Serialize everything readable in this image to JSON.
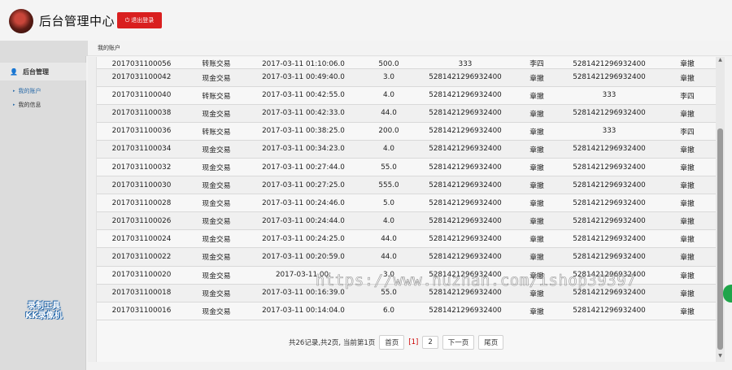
{
  "header": {
    "title": "后台管理中心",
    "logout_label": "退出登录"
  },
  "breadcrumb": "我的账户",
  "sidebar": {
    "group_label": "后台管理",
    "items": [
      {
        "label": "我的账户"
      },
      {
        "label": "我的信息"
      }
    ],
    "recorder_watermark_line1": "录制工具",
    "recorder_watermark_line2": "KK录像机"
  },
  "table": {
    "rows": [
      [
        "2017031100056",
        "转账交易",
        "2017-03-11 01:10:06.0",
        "500.0",
        "333",
        "李四",
        "5281421296932400",
        "章撤"
      ],
      [
        "2017031100042",
        "现金交易",
        "2017-03-11 00:49:40.0",
        "3.0",
        "5281421296932400",
        "章撤",
        "5281421296932400",
        "章撤"
      ],
      [
        "2017031100040",
        "转账交易",
        "2017-03-11 00:42:55.0",
        "4.0",
        "5281421296932400",
        "章撤",
        "333",
        "李四"
      ],
      [
        "2017031100038",
        "现金交易",
        "2017-03-11 00:42:33.0",
        "44.0",
        "5281421296932400",
        "章撤",
        "5281421296932400",
        "章撤"
      ],
      [
        "2017031100036",
        "转账交易",
        "2017-03-11 00:38:25.0",
        "200.0",
        "5281421296932400",
        "章撤",
        "333",
        "李四"
      ],
      [
        "2017031100034",
        "现金交易",
        "2017-03-11 00:34:23.0",
        "4.0",
        "5281421296932400",
        "章撤",
        "5281421296932400",
        "章撤"
      ],
      [
        "2017031100032",
        "现金交易",
        "2017-03-11 00:27:44.0",
        "55.0",
        "5281421296932400",
        "章撤",
        "5281421296932400",
        "章撤"
      ],
      [
        "2017031100030",
        "现金交易",
        "2017-03-11 00:27:25.0",
        "555.0",
        "5281421296932400",
        "章撤",
        "5281421296932400",
        "章撤"
      ],
      [
        "2017031100028",
        "现金交易",
        "2017-03-11 00:24:46.0",
        "5.0",
        "5281421296932400",
        "章撤",
        "5281421296932400",
        "章撤"
      ],
      [
        "2017031100026",
        "现金交易",
        "2017-03-11 00:24:44.0",
        "4.0",
        "5281421296932400",
        "章撤",
        "5281421296932400",
        "章撤"
      ],
      [
        "2017031100024",
        "现金交易",
        "2017-03-11 00:24:25.0",
        "44.0",
        "5281421296932400",
        "章撤",
        "5281421296932400",
        "章撤"
      ],
      [
        "2017031100022",
        "现金交易",
        "2017-03-11 00:20:59.0",
        "44.0",
        "5281421296932400",
        "章撤",
        "5281421296932400",
        "章撤"
      ],
      [
        "2017031100020",
        "现金交易",
        "2017-03-11 00:",
        "3.0",
        "5281421296932400",
        "章撤",
        "5281421296932400",
        "章撤"
      ],
      [
        "2017031100018",
        "现金交易",
        "2017-03-11 00:16:39.0",
        "55.0",
        "5281421296932400",
        "章撤",
        "5281421296932400",
        "章撤"
      ],
      [
        "2017031100016",
        "现金交易",
        "2017-03-11 00:14:04.0",
        "6.0",
        "5281421296932400",
        "章撤",
        "5281421296932400",
        "章撤"
      ]
    ]
  },
  "pager": {
    "summary": "共26记录,共2页, 当前第1页",
    "first": "首页",
    "page1": "[1]",
    "page2": "2",
    "next": "下一页",
    "last": "尾页"
  },
  "url_watermark": "https://www.huzhan.com/ishop39397",
  "colors": {
    "logout": "#d91f1f",
    "link": "#2a6ba8",
    "current_page": "#cc0000",
    "float_button": "#1fa54a"
  }
}
